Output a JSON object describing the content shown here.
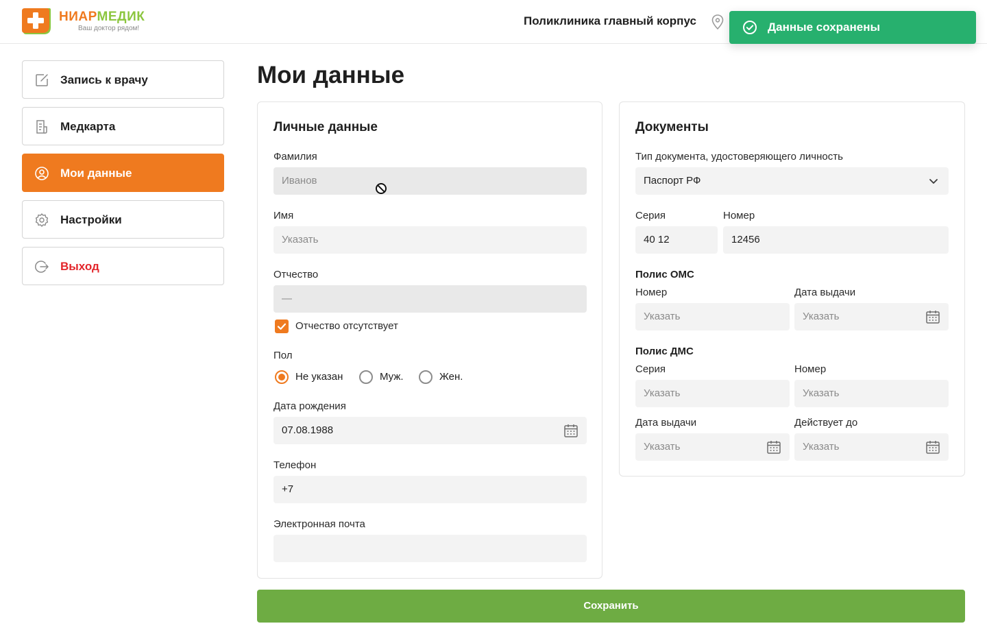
{
  "header": {
    "logo_name_part1": "НИАР",
    "logo_name_part2": "МЕДИК",
    "logo_tagline": "Ваш доктор рядом!",
    "clinic": "Поликлиника главный корпус"
  },
  "toast": {
    "text": "Данные сохранены",
    "icon": "check-circle-icon"
  },
  "sidebar": {
    "items": [
      {
        "label": "Запись к врачу",
        "icon": "edit-icon"
      },
      {
        "label": "Медкарта",
        "icon": "document-icon"
      },
      {
        "label": "Мои данные",
        "icon": "user-icon",
        "active": true
      },
      {
        "label": "Настройки",
        "icon": "gear-icon"
      },
      {
        "label": "Выход",
        "icon": "logout-icon"
      }
    ]
  },
  "page": {
    "title": "Мои данные"
  },
  "personal": {
    "title": "Личные данные",
    "lastname": {
      "label": "Фамилия",
      "placeholder": "Иванов"
    },
    "firstname": {
      "label": "Имя",
      "placeholder": "Указать"
    },
    "patronymic": {
      "label": "Отчество",
      "placeholder": "—"
    },
    "no_patronymic": {
      "label": "Отчество отсутствует",
      "checked": true
    },
    "gender": {
      "label": "Пол",
      "options": [
        "Не указан",
        "Муж.",
        "Жен."
      ],
      "selected": "Не указан"
    },
    "birthdate": {
      "label": "Дата рождения",
      "value": "07.08.1988"
    },
    "phone": {
      "label": "Телефон",
      "value": "+7"
    },
    "email": {
      "label": "Электронная почта",
      "value": ""
    }
  },
  "documents": {
    "title": "Документы",
    "id_type": {
      "label": "Тип документа, удостоверяющего личность",
      "value": "Паспорт РФ"
    },
    "series": {
      "label": "Серия",
      "value": "40 12"
    },
    "number": {
      "label": "Номер",
      "value": "12456"
    },
    "oms": {
      "title": "Полис ОМС",
      "number_label": "Номер",
      "number_placeholder": "Указать",
      "date_label": "Дата выдачи",
      "date_placeholder": "Указать"
    },
    "dms": {
      "title": "Полис ДМС",
      "series_label": "Серия",
      "series_placeholder": "Указать",
      "number_label": "Номер",
      "number_placeholder": "Указать",
      "issue_label": "Дата выдачи",
      "issue_placeholder": "Указать",
      "valid_label": "Действует до",
      "valid_placeholder": "Указать"
    }
  },
  "save_button": {
    "label": "Сохранить"
  },
  "colors": {
    "accent": "#ef7a1f",
    "success": "#27b06e",
    "save": "#6eac43",
    "danger": "#e3262b"
  }
}
